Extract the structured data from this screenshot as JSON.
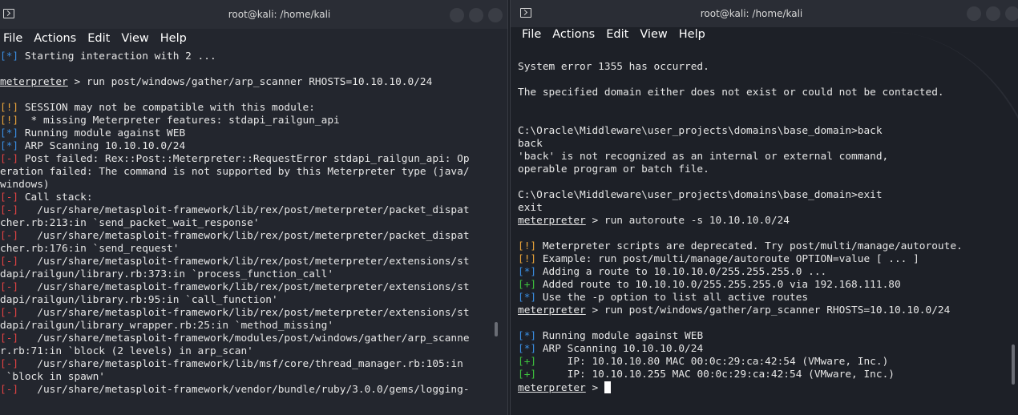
{
  "left": {
    "title": "root@kali: /home/kali",
    "menu": [
      "File",
      "Actions",
      "Edit",
      "View",
      "Help"
    ],
    "lines": [
      [
        {
          "t": "[*]",
          "c": "c-blue"
        },
        {
          "t": " Starting interaction with 2 ..."
        }
      ],
      [
        {
          "t": ""
        }
      ],
      [
        {
          "t": "meterpreter",
          "c": "u"
        },
        {
          "t": " > run post/windows/gather/arp_scanner RHOSTS=10.10.10.0/24"
        }
      ],
      [
        {
          "t": ""
        }
      ],
      [
        {
          "t": "[!]",
          "c": "c-orange"
        },
        {
          "t": " SESSION may not be compatible with this module:"
        }
      ],
      [
        {
          "t": "[!]",
          "c": "c-orange"
        },
        {
          "t": "  * missing Meterpreter features: stdapi_railgun_api"
        }
      ],
      [
        {
          "t": "[*]",
          "c": "c-blue"
        },
        {
          "t": " Running module against WEB"
        }
      ],
      [
        {
          "t": "[*]",
          "c": "c-blue"
        },
        {
          "t": " ARP Scanning 10.10.10.0/24"
        }
      ],
      [
        {
          "t": "[-]",
          "c": "c-red"
        },
        {
          "t": " Post failed: Rex::Post::Meterpreter::RequestError stdapi_railgun_api: Op"
        }
      ],
      [
        {
          "t": "eration failed: The command is not supported by this Meterpreter type (java/"
        }
      ],
      [
        {
          "t": "windows)"
        }
      ],
      [
        {
          "t": "[-]",
          "c": "c-red"
        },
        {
          "t": " Call stack:"
        }
      ],
      [
        {
          "t": "[-]",
          "c": "c-red"
        },
        {
          "t": "   /usr/share/metasploit-framework/lib/rex/post/meterpreter/packet_dispat"
        }
      ],
      [
        {
          "t": "cher.rb:213:in `send_packet_wait_response'"
        }
      ],
      [
        {
          "t": "[-]",
          "c": "c-red"
        },
        {
          "t": "   /usr/share/metasploit-framework/lib/rex/post/meterpreter/packet_dispat"
        }
      ],
      [
        {
          "t": "cher.rb:176:in `send_request'"
        }
      ],
      [
        {
          "t": "[-]",
          "c": "c-red"
        },
        {
          "t": "   /usr/share/metasploit-framework/lib/rex/post/meterpreter/extensions/st"
        }
      ],
      [
        {
          "t": "dapi/railgun/library.rb:373:in `process_function_call'"
        }
      ],
      [
        {
          "t": "[-]",
          "c": "c-red"
        },
        {
          "t": "   /usr/share/metasploit-framework/lib/rex/post/meterpreter/extensions/st"
        }
      ],
      [
        {
          "t": "dapi/railgun/library.rb:95:in `call_function'"
        }
      ],
      [
        {
          "t": "[-]",
          "c": "c-red"
        },
        {
          "t": "   /usr/share/metasploit-framework/lib/rex/post/meterpreter/extensions/st"
        }
      ],
      [
        {
          "t": "dapi/railgun/library_wrapper.rb:25:in `method_missing'"
        }
      ],
      [
        {
          "t": "[-]",
          "c": "c-red"
        },
        {
          "t": "   /usr/share/metasploit-framework/modules/post/windows/gather/arp_scanne"
        }
      ],
      [
        {
          "t": "r.rb:71:in `block (2 levels) in arp_scan'"
        }
      ],
      [
        {
          "t": "[-]",
          "c": "c-red"
        },
        {
          "t": "   /usr/share/metasploit-framework/lib/msf/core/thread_manager.rb:105:in"
        }
      ],
      [
        {
          "t": " `block in spawn'"
        }
      ],
      [
        {
          "t": "[-]",
          "c": "c-red"
        },
        {
          "t": "   /usr/share/metasploit-framework/vendor/bundle/ruby/3.0.0/gems/logging-"
        }
      ]
    ]
  },
  "right": {
    "title": "root@kali: /home/kali",
    "menu": [
      "File",
      "Actions",
      "Edit",
      "View",
      "Help"
    ],
    "lines": [
      [
        {
          "t": "System error 1355 has occurred."
        }
      ],
      [
        {
          "t": ""
        }
      ],
      [
        {
          "t": "The specified domain either does not exist or could not be contacted."
        }
      ],
      [
        {
          "t": ""
        }
      ],
      [
        {
          "t": ""
        }
      ],
      [
        {
          "t": "C:\\Oracle\\Middleware\\user_projects\\domains\\base_domain>back"
        }
      ],
      [
        {
          "t": "back"
        }
      ],
      [
        {
          "t": "'back' is not recognized as an internal or external command,"
        }
      ],
      [
        {
          "t": "operable program or batch file."
        }
      ],
      [
        {
          "t": ""
        }
      ],
      [
        {
          "t": "C:\\Oracle\\Middleware\\user_projects\\domains\\base_domain>exit"
        }
      ],
      [
        {
          "t": "exit"
        }
      ],
      [
        {
          "t": "meterpreter",
          "c": "u"
        },
        {
          "t": " > run autoroute -s 10.10.10.0/24"
        }
      ],
      [
        {
          "t": ""
        }
      ],
      [
        {
          "t": "[!]",
          "c": "c-orange"
        },
        {
          "t": " Meterpreter scripts are deprecated. Try post/multi/manage/autoroute."
        }
      ],
      [
        {
          "t": "[!]",
          "c": "c-orange"
        },
        {
          "t": " Example: run post/multi/manage/autoroute OPTION=value [ ... ]"
        }
      ],
      [
        {
          "t": "[*]",
          "c": "c-blue"
        },
        {
          "t": " Adding a route to 10.10.10.0/255.255.255.0 ..."
        }
      ],
      [
        {
          "t": "[+]",
          "c": "c-green"
        },
        {
          "t": " Added route to 10.10.10.0/255.255.255.0 via 192.168.111.80"
        }
      ],
      [
        {
          "t": "[*]",
          "c": "c-blue"
        },
        {
          "t": " Use the -p option to list all active routes"
        }
      ],
      [
        {
          "t": "meterpreter",
          "c": "u"
        },
        {
          "t": " > run post/windows/gather/arp_scanner RHOSTS=10.10.10.0/24"
        }
      ],
      [
        {
          "t": ""
        }
      ],
      [
        {
          "t": "[*]",
          "c": "c-blue"
        },
        {
          "t": " Running module against WEB"
        }
      ],
      [
        {
          "t": "[*]",
          "c": "c-blue"
        },
        {
          "t": " ARP Scanning 10.10.10.0/24"
        }
      ],
      [
        {
          "t": "[+]",
          "c": "c-green"
        },
        {
          "t": "     IP: 10.10.10.80 MAC 00:0c:29:ca:42:54 (VMware, Inc.)"
        }
      ],
      [
        {
          "t": "[+]",
          "c": "c-green"
        },
        {
          "t": "     IP: 10.10.10.255 MAC 00:0c:29:ca:42:54 (VMware, Inc.)"
        }
      ],
      [
        {
          "t": "meterpreter",
          "c": "u"
        },
        {
          "t": " > "
        },
        {
          "cursor": true
        }
      ]
    ]
  },
  "colors": {
    "blue": "#3a8de0",
    "green": "#3ec23e",
    "orange": "#e8a33a",
    "red": "#e14343",
    "background": "#1d2027"
  },
  "icons": [
    "terminal-icon",
    "window-button"
  ]
}
